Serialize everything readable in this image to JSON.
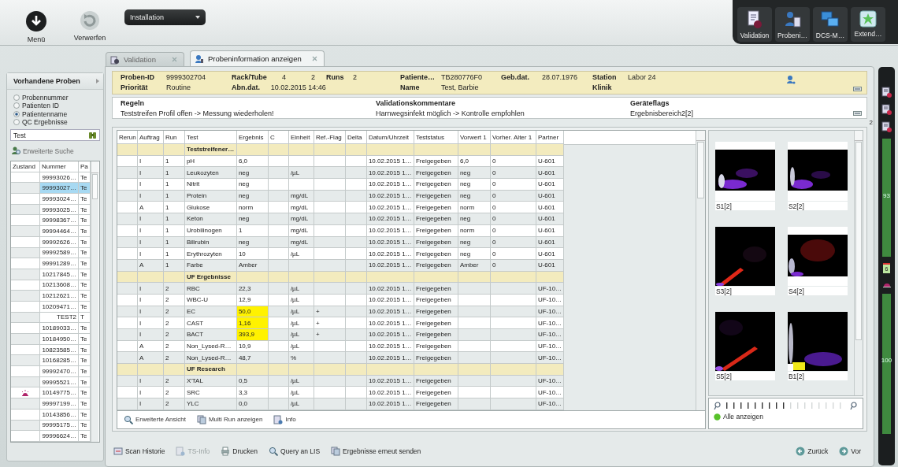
{
  "toolbar": {
    "buttons": [
      {
        "kind": "menu",
        "label": "Menü"
      },
      {
        "kind": "discard",
        "label": "Verwerfen"
      }
    ],
    "dropdown": {
      "value": "Installation"
    }
  },
  "app_launcher": [
    {
      "kind": "validation",
      "label": "Validation"
    },
    {
      "kind": "sample",
      "label": "Probeni…"
    },
    {
      "kind": "network",
      "label": "DCS-M…"
    },
    {
      "kind": "extend",
      "label": "Extend…"
    }
  ],
  "sidebar": {
    "title": "Vorhandene Proben",
    "search_by": [
      {
        "label": "Probennummer",
        "selected": false
      },
      {
        "label": "Patienten ID",
        "selected": false
      },
      {
        "label": "Patientenname",
        "selected": true
      },
      {
        "label": "QC Ergebnisse",
        "selected": false
      }
    ],
    "search": {
      "value": "Test"
    },
    "advanced_search": "Erweiterte Suche",
    "columns": [
      "Zustand",
      "Nummer",
      "Pa"
    ],
    "rows": [
      {
        "number": "99993026…",
        "patient": "Te",
        "selected": false,
        "alert": false
      },
      {
        "number": "99993027…",
        "patient": "Te",
        "selected": true,
        "alert": false
      },
      {
        "number": "99993024…",
        "patient": "Te",
        "selected": false,
        "alert": false
      },
      {
        "number": "99993025…",
        "patient": "Te",
        "selected": false,
        "alert": false
      },
      {
        "number": "99998367…",
        "patient": "Te",
        "selected": false,
        "alert": false
      },
      {
        "number": "99994464…",
        "patient": "Te",
        "selected": false,
        "alert": false
      },
      {
        "number": "99992626…",
        "patient": "Te",
        "selected": false,
        "alert": false
      },
      {
        "number": "99992589…",
        "patient": "Te",
        "selected": false,
        "alert": false
      },
      {
        "number": "99991289…",
        "patient": "Te",
        "selected": false,
        "alert": false
      },
      {
        "number": "10217845…",
        "patient": "Te",
        "selected": false,
        "alert": false
      },
      {
        "number": "10213608…",
        "patient": "Te",
        "selected": false,
        "alert": false
      },
      {
        "number": "10212621…",
        "patient": "Te",
        "selected": false,
        "alert": false
      },
      {
        "number": "10209471…",
        "patient": "Te",
        "selected": false,
        "alert": false
      },
      {
        "number": "TEST2",
        "patient": "T",
        "selected": false,
        "alert": false
      },
      {
        "number": "10189033…",
        "patient": "Te",
        "selected": false,
        "alert": false
      },
      {
        "number": "10184950…",
        "patient": "Te",
        "selected": false,
        "alert": false
      },
      {
        "number": "10823585…",
        "patient": "Te",
        "selected": false,
        "alert": false
      },
      {
        "number": "10168285…",
        "patient": "Te",
        "selected": false,
        "alert": false
      },
      {
        "number": "99992470…",
        "patient": "Te",
        "selected": false,
        "alert": false
      },
      {
        "number": "99995521…",
        "patient": "Te",
        "selected": false,
        "alert": false
      },
      {
        "number": "10149775…",
        "patient": "Te",
        "selected": false,
        "alert": true
      },
      {
        "number": "99997199…",
        "patient": "Te",
        "selected": false,
        "alert": false
      },
      {
        "number": "10143856…",
        "patient": "Te",
        "selected": false,
        "alert": false
      },
      {
        "number": "99995175…",
        "patient": "Te",
        "selected": false,
        "alert": false
      },
      {
        "number": "99996624…",
        "patient": "Te",
        "selected": false,
        "alert": false
      }
    ]
  },
  "tabs": [
    {
      "label": "Validation",
      "selected": false
    },
    {
      "label": "Probeninformation anzeigen",
      "selected": true
    }
  ],
  "sample_info": {
    "columns": [
      {
        "top": {
          "label": "Proben-ID",
          "values": [
            "9999302704"
          ]
        },
        "bottom": {
          "label": "Priorität",
          "values": [
            "Routine"
          ]
        }
      },
      {
        "top": {
          "label": "Rack/Tube",
          "values": [
            "4",
            "2"
          ]
        },
        "bottom": {
          "label": "Abn.dat.",
          "values": [
            "10.02.2015 14:46"
          ]
        }
      },
      {
        "top": {
          "label": "Runs",
          "values": [
            "2"
          ]
        }
      },
      {
        "top": {
          "label": "Patiente…",
          "values": [
            "TB280776F0"
          ]
        },
        "bottom": {
          "label": "Name",
          "values": [
            "Test, Barbie"
          ]
        }
      },
      {
        "top": {
          "label": "Geb.dat.",
          "values": [
            "28.07.1976"
          ]
        }
      },
      {
        "top": {
          "label": "Station",
          "values": [
            "Labor 24"
          ]
        },
        "bottom": {
          "label": "Klinik"
        }
      }
    ]
  },
  "notes": [
    {
      "title": "Regeln",
      "text": "Teststreifen Profil offen -> Messung wiederholen!"
    },
    {
      "title": "Validationskommentare",
      "text": "Harnwegsinfekt möglich -> Kontrolle empfohlen"
    },
    {
      "title": "Geräteflags",
      "text": "Ergebnisbereich2[2]"
    }
  ],
  "side_note": "2",
  "results_table": {
    "columns": [
      "Rerun",
      "Auftrag",
      "Run",
      "Test",
      "Ergebnis",
      "C",
      "Einheit",
      "Ref.-Flag",
      "Delta",
      "Datum/Uhrzeit",
      "Teststatus",
      "Vorwert 1",
      "Vorher. Alter 1",
      "Partner"
    ],
    "rows": [
      {
        "kind": "group",
        "label": "Teststreifener…"
      },
      {
        "kind": "result",
        "auftrag": "I",
        "run": "1",
        "test": "pH",
        "result": "6,0",
        "date": "10.02.2015 1…",
        "status": "Freigegeben",
        "prev": "6,0",
        "prev_age": "0",
        "partner": "U-601",
        "flagged": false
      },
      {
        "kind": "result",
        "auftrag": "I",
        "run": "1",
        "test": "Leukozyten",
        "result": "neg",
        "unit": "/µL",
        "date": "10.02.2015 1…",
        "status": "Freigegeben",
        "prev": "neg",
        "prev_age": "0",
        "partner": "U-601",
        "flagged": false
      },
      {
        "kind": "result",
        "auftrag": "I",
        "run": "1",
        "test": "Nitrit",
        "result": "neg",
        "date": "10.02.2015 1…",
        "status": "Freigegeben",
        "prev": "neg",
        "prev_age": "0",
        "partner": "U-601",
        "flagged": false
      },
      {
        "kind": "result",
        "auftrag": "I",
        "run": "1",
        "test": "Protein",
        "result": "neg",
        "unit": "mg/dL",
        "date": "10.02.2015 1…",
        "status": "Freigegeben",
        "prev": "neg",
        "prev_age": "0",
        "partner": "U-601",
        "flagged": false
      },
      {
        "kind": "result",
        "auftrag": "A",
        "run": "1",
        "test": "Glukose",
        "result": "norm",
        "unit": "mg/dL",
        "date": "10.02.2015 1…",
        "status": "Freigegeben",
        "prev": "norm",
        "prev_age": "0",
        "partner": "U-601",
        "flagged": false
      },
      {
        "kind": "result",
        "auftrag": "I",
        "run": "1",
        "test": "Keton",
        "result": "neg",
        "unit": "mg/dL",
        "date": "10.02.2015 1…",
        "status": "Freigegeben",
        "prev": "neg",
        "prev_age": "0",
        "partner": "U-601",
        "flagged": false
      },
      {
        "kind": "result",
        "auftrag": "I",
        "run": "1",
        "test": "Urobilinogen",
        "result": "1",
        "unit": "mg/dL",
        "date": "10.02.2015 1…",
        "status": "Freigegeben",
        "prev": "norm",
        "prev_age": "0",
        "partner": "U-601",
        "flagged": false
      },
      {
        "kind": "result",
        "auftrag": "I",
        "run": "1",
        "test": "Bilirubin",
        "result": "neg",
        "unit": "mg/dL",
        "date": "10.02.2015 1…",
        "status": "Freigegeben",
        "prev": "neg",
        "prev_age": "0",
        "partner": "U-601",
        "flagged": false
      },
      {
        "kind": "result",
        "auftrag": "I",
        "run": "1",
        "test": "Erythrozyten",
        "result": "10",
        "unit": "/µL",
        "date": "10.02.2015 1…",
        "status": "Freigegeben",
        "prev": "neg",
        "prev_age": "0",
        "partner": "U-601",
        "flagged": false
      },
      {
        "kind": "result",
        "auftrag": "A",
        "run": "1",
        "test": "Farbe",
        "result": "Amber",
        "date": "10.02.2015 1…",
        "status": "Freigegeben",
        "prev": "Amber",
        "prev_age": "0",
        "partner": "U-601",
        "flagged": false
      },
      {
        "kind": "group",
        "label": "UF Ergebnisse"
      },
      {
        "kind": "result",
        "auftrag": "I",
        "run": "2",
        "test": "RBC",
        "result": "22,3",
        "unit": "/µL",
        "date": "10.02.2015 1…",
        "status": "Freigegeben",
        "partner": "UF-10…",
        "flagged": false
      },
      {
        "kind": "result",
        "auftrag": "I",
        "run": "2",
        "test": "WBC-U",
        "result": "12,9",
        "unit": "/µL",
        "date": "10.02.2015 1…",
        "status": "Freigegeben",
        "partner": "UF-10…",
        "flagged": false
      },
      {
        "kind": "result",
        "auftrag": "I",
        "run": "2",
        "test": "EC",
        "result": "50,0",
        "unit": "/µL",
        "flag": "+",
        "date": "10.02.2015 1…",
        "status": "Freigegeben",
        "partner": "UF-10…",
        "flagged": true
      },
      {
        "kind": "result",
        "auftrag": "I",
        "run": "2",
        "test": "CAST",
        "result": "1,16",
        "unit": "/µL",
        "flag": "+",
        "date": "10.02.2015 1…",
        "status": "Freigegeben",
        "partner": "UF-10…",
        "flagged": true
      },
      {
        "kind": "result",
        "auftrag": "I",
        "run": "2",
        "test": "BACT",
        "result": "393,9",
        "unit": "/µL",
        "flag": "+",
        "date": "10.02.2015 1…",
        "status": "Freigegeben",
        "partner": "UF-10…",
        "flagged": true
      },
      {
        "kind": "result",
        "auftrag": "A",
        "run": "2",
        "test": "Non_Lysed-R…",
        "result": "10,9",
        "unit": "/µL",
        "date": "10.02.2015 1…",
        "status": "Freigegeben",
        "partner": "UF-10…",
        "flagged": false
      },
      {
        "kind": "result",
        "auftrag": "A",
        "run": "2",
        "test": "Non_Lysed-R…",
        "result": "48,7",
        "unit": "%",
        "date": "10.02.2015 1…",
        "status": "Freigegeben",
        "partner": "UF-10…",
        "flagged": false
      },
      {
        "kind": "group",
        "label": "UF Research"
      },
      {
        "kind": "result",
        "auftrag": "I",
        "run": "2",
        "test": "X'TAL",
        "result": "0,5",
        "unit": "/µL",
        "date": "10.02.2015 1…",
        "status": "Freigegeben",
        "partner": "UF-10…",
        "flagged": false
      },
      {
        "kind": "result",
        "auftrag": "I",
        "run": "2",
        "test": "SRC",
        "result": "3,3",
        "unit": "/µL",
        "date": "10.02.2015 1…",
        "status": "Freigegeben",
        "partner": "UF-10…",
        "flagged": false
      },
      {
        "kind": "result",
        "auftrag": "I",
        "run": "2",
        "test": "YLC",
        "result": "0,0",
        "unit": "/µL",
        "date": "10.02.2015 1…",
        "status": "Freigegeben",
        "partner": "UF-10…",
        "flagged": false
      }
    ]
  },
  "table_actions": [
    {
      "kind": "zoom",
      "label": "Erweiterte Ansicht"
    },
    {
      "kind": "multi",
      "label": "Multi Run anzeigen"
    },
    {
      "kind": "info",
      "label": "Info"
    }
  ],
  "scattergrams": {
    "plots": [
      {
        "label": "S1[2]",
        "kind": "picture"
      },
      {
        "label": "S2[2]",
        "kind": "picture"
      },
      {
        "label": "S3[2]",
        "kind": "picture"
      },
      {
        "label": "S4[2]",
        "kind": "picture"
      },
      {
        "label": "S5[2]",
        "kind": "picture"
      },
      {
        "label": "B1[2]",
        "kind": "picture"
      }
    ],
    "show_all": "Alle anzeigen"
  },
  "bottom_actions": [
    {
      "kind": "scan",
      "label": "Scan Historie",
      "disabled": false
    },
    {
      "kind": "info",
      "label": "TS-Info",
      "disabled": true
    },
    {
      "kind": "print",
      "label": "Drucken",
      "disabled": false
    },
    {
      "kind": "query",
      "label": "Query an LIS",
      "disabled": false
    },
    {
      "kind": "send",
      "label": "Ergebnisse erneut senden",
      "disabled": false
    }
  ],
  "navigation": [
    {
      "kind": "back",
      "label": "Zurück"
    },
    {
      "kind": "forward",
      "label": "Vor"
    }
  ],
  "status_strip": {
    "gauges": [
      {
        "reading": "93",
        "level": 1
      },
      {
        "reading": "100",
        "level": 1
      }
    ],
    "counter": "6"
  }
}
